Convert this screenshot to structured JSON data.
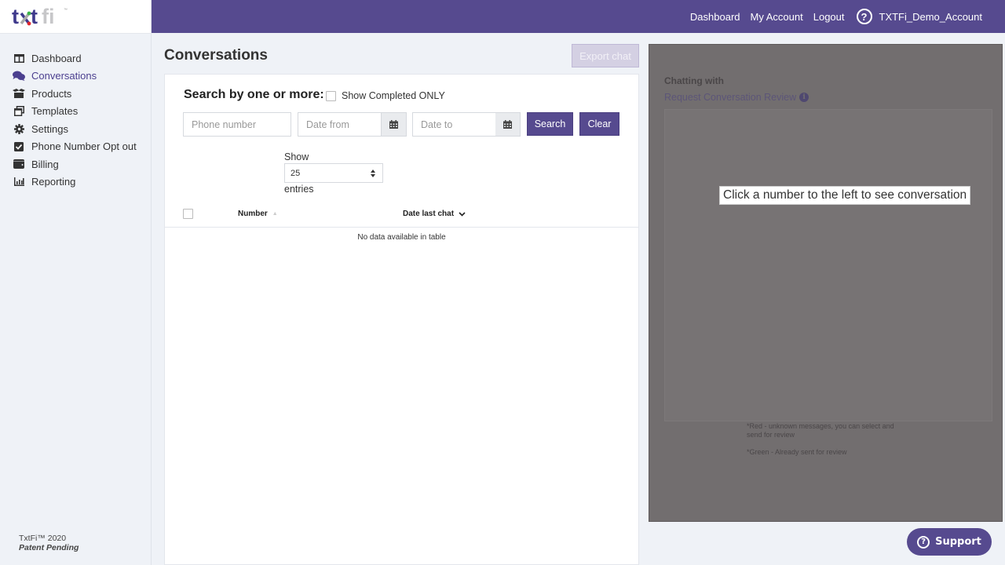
{
  "logo": {
    "text": "txtfi",
    "trademark": "™"
  },
  "topbar": {
    "links": [
      "Dashboard",
      "My Account",
      "Logout"
    ],
    "help_icon": "question-circle-icon",
    "account_name": "TXTFi_Demo_Account"
  },
  "sidebar": {
    "items": [
      {
        "label": "Dashboard",
        "icon": "columns-icon",
        "active": false
      },
      {
        "label": "Conversations",
        "icon": "comments-icon",
        "active": true
      },
      {
        "label": "Products",
        "icon": "box-icon",
        "active": false
      },
      {
        "label": "Templates",
        "icon": "window-restore-icon",
        "active": false
      },
      {
        "label": "Settings",
        "icon": "gear-icon",
        "active": false
      },
      {
        "label": "Phone Number Opt out",
        "icon": "check-square-icon",
        "active": false
      },
      {
        "label": "Billing",
        "icon": "wallet-icon",
        "active": false
      },
      {
        "label": "Reporting",
        "icon": "bar-chart-icon",
        "active": false
      }
    ],
    "footer": {
      "copyright": "TxtFi™ 2020",
      "patent": "Patent Pending"
    }
  },
  "main": {
    "title": "Conversations",
    "export_label": "Export chat",
    "search": {
      "label": "Search by one or more:",
      "completed_only_label": "Show Completed ONLY",
      "completed_only_checked": false,
      "phone_placeholder": "Phone number",
      "phone_value": "",
      "date_from_placeholder": "Date from",
      "date_from_value": "",
      "date_to_placeholder": "Date to",
      "date_to_value": "",
      "search_label": "Search",
      "clear_label": "Clear"
    },
    "length": {
      "show_label": "Show",
      "selected": "25",
      "entries_label": "entries"
    },
    "table": {
      "columns": [
        "Number",
        "Date last chat"
      ],
      "sorted_column": "Date last chat",
      "sort_direction": "desc",
      "rows": [],
      "empty_message": "No data available in table"
    }
  },
  "chat": {
    "chatting_with_label": "Chatting with",
    "request_review_label": "Request Conversation Review",
    "placeholder": "Click a number to the left to see conversation",
    "legend": [
      "*Red - unknown messages, you can select and send for review",
      "*Green - Already sent for review"
    ]
  },
  "support": {
    "label": "Support"
  },
  "colors": {
    "brand": "#564a8f",
    "active_nav": "#4b3f8f",
    "overlay": "#726e6f"
  }
}
